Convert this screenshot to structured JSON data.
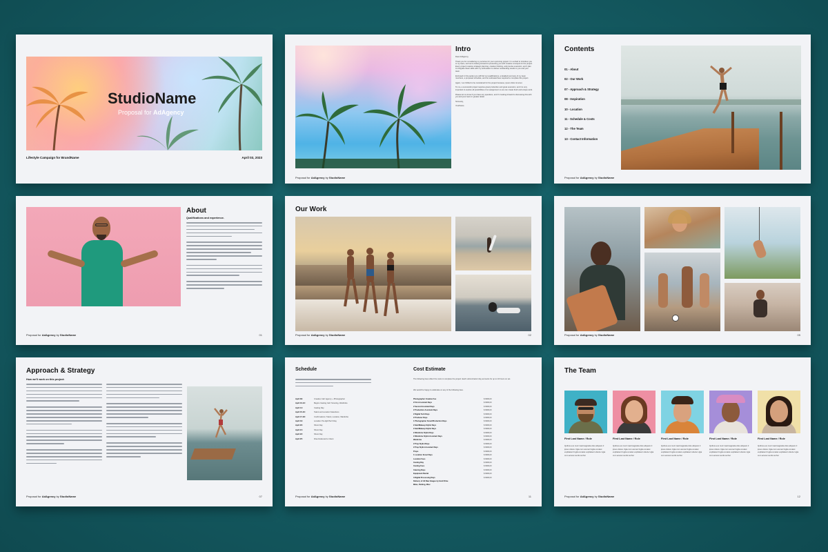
{
  "pages": {
    "cover": {
      "studio_name": "StudioName",
      "proposal_prefix": "Proposal for ",
      "agency": "AdAgency",
      "campaign": "Lifestyle Campaign for BrandName",
      "date": "April 03, 2023"
    },
    "intro": {
      "title": "Intro",
      "greeting": "Dear AdAgency,",
      "p1": "Thank you for considering my services for your upcoming project. I'm excited to introduce you to my team, and we're looking forward to presenting you with creative concepts for the project. Every project requires strategic planning, creative thinking, and precise execution, and I plan to integrate these skills with my enthusiasm to deliver outstanding results to you and your team.",
      "p2": "Enclosed in this packet you will find our qualifications, a detailed summary of my team members, a proposed schedule, and the estimated fees required to complete this project.",
      "p3": "Again, I am thrilled to be considered for the project because, ipsum dolor sit amet.",
      "p4": "To me, a successful project requires great production and great execution, and it is very important to explore all possibilities of an assignment so we can create fresh and unique work.",
      "p5": "Please let me know if you have any questions, and I'm looking forward to discussing this with you and your team in greater detail.",
      "closing": "Sincerely,",
      "signature": "YourName"
    },
    "contents": {
      "title": "Contents",
      "items": [
        "01 - About",
        "02 - Our Work",
        "07 - Approach & Strategy",
        "08 - Inspiration",
        "10 - Location",
        "11 - Schedule & Costs",
        "12 - The Team",
        "13 - Contact Information"
      ]
    },
    "about": {
      "title": "About",
      "subtitle": "Qualifications and experience.",
      "page_number": "01"
    },
    "our_work": {
      "title": "Our Work",
      "page_number": "02"
    },
    "gallery": {
      "page_number": "05"
    },
    "approach": {
      "title": "Approach & Strategy",
      "subtitle": "How we'll work on this project:",
      "page_number": "07"
    },
    "schedule": {
      "title": "Schedule",
      "dates": [
        "April 09:",
        "April 10-13:",
        "April 14:",
        "April 15-16:",
        "April 17-18:",
        "April 19:",
        "April 20:",
        "April 21:",
        "April 22:",
        "April 25:"
      ],
      "tasks": [
        "Creative Call: Agency + Photographer",
        "Begins Casting Call: Scouting, Wardrobe",
        "Casting Day",
        "Talent and Location Selections",
        "Confirmations: Talent, Location, Wardrobe",
        "Location Pre-light/Tech Day",
        "Shoot Day",
        "Shoot Day",
        "Shoot Day",
        "Files Delivered to Client"
      ],
      "page_number": "11"
    },
    "cost": {
      "title": "Cost Estimate",
      "intro": "The following fees reflect the costs to complete the project. Each subcontractor day accounts for up to 10 hours on set.",
      "note": "We would be happy to elaborate on any of the following fees.",
      "items": [
        "Photographer Creative Fee",
        "2 First Assistant Days",
        "2 Second Assistant Days",
        "2 Production Assistant Days",
        "2 Digital Tech Days",
        "2 Producer Days",
        "1 Photographer Scout/Production Days",
        "2 Hair/Makeup Stylist Days",
        "2 Hair/Makeup Stylist Days",
        "2 Wardrobe Stylist Days",
        "2 Wardrobe Stylist Assistant Days",
        "Wardrobe",
        "2 Prop Stylist Days",
        "2 Prop Stylist Assistant Days",
        "Props",
        "1 Location Scout Days",
        "Location Fees",
        "Casting Day",
        "Casting Fees",
        "Catering Days",
        "Equipment Rental",
        "3 Digital Processing Days",
        "Delivery of All Raw Images by Hard Drive",
        "Miles, Parking, Misc"
      ],
      "amount": "$ 9999,00"
    },
    "team": {
      "title": "The Team",
      "members": [
        {
          "role": "First Last Name / Role",
          "bio": "Quibus eos mod maximagnatia dolo aliquam il ipsus dolore Ugia cum aconet fugita conatet explitatent fugita conatet explitatent ullecte Ugia cum aconet sunlis surhur"
        },
        {
          "role": "First Last Name / Role",
          "bio": "Quibus eos mod maximagnatia dolo aliquam il ipsus dolore Ugia cum aconet fugita conatet explitatent fugita conatet explitatent ullecte Ugia cum aconet sunlis surhur"
        },
        {
          "role": "First Last Name / Role",
          "bio": "Quibus eos mod maximagnatia dolo aliquam il ipsus dolore Ugia cum aconet fugita conatet explitatent fugita conatet explitatent ullecte Ugia cum aconet sunlis surhur"
        },
        {
          "role": "First Last Name / Role",
          "bio": "Quibus eos mod maximagnatia dolo aliquam il ipsus dolore Ugia cum aconet fugita conatet explitatent fugita conatet explitatent ullecte Ugia cum aconet sunlis surhur"
        },
        {
          "role": "First Last Name / Role",
          "bio": "Quibus eos mod maximagnatia dolo aliquam il ipsus dolore Ugia cum aconet fugita conatet explitatent fugita conatet explitatent ullecte Ugia cum aconet sunlis surhur"
        }
      ],
      "page_number": "12"
    }
  },
  "footer": {
    "prefix": "Proposal for ",
    "agency": "AdAgency",
    "by": " by ",
    "studio": "StudioName"
  },
  "colors": {
    "background": "#145a61",
    "page": "#f2f3f6",
    "accent_pink": "#f3a8b8",
    "shirt_green": "#1f9a7d"
  }
}
